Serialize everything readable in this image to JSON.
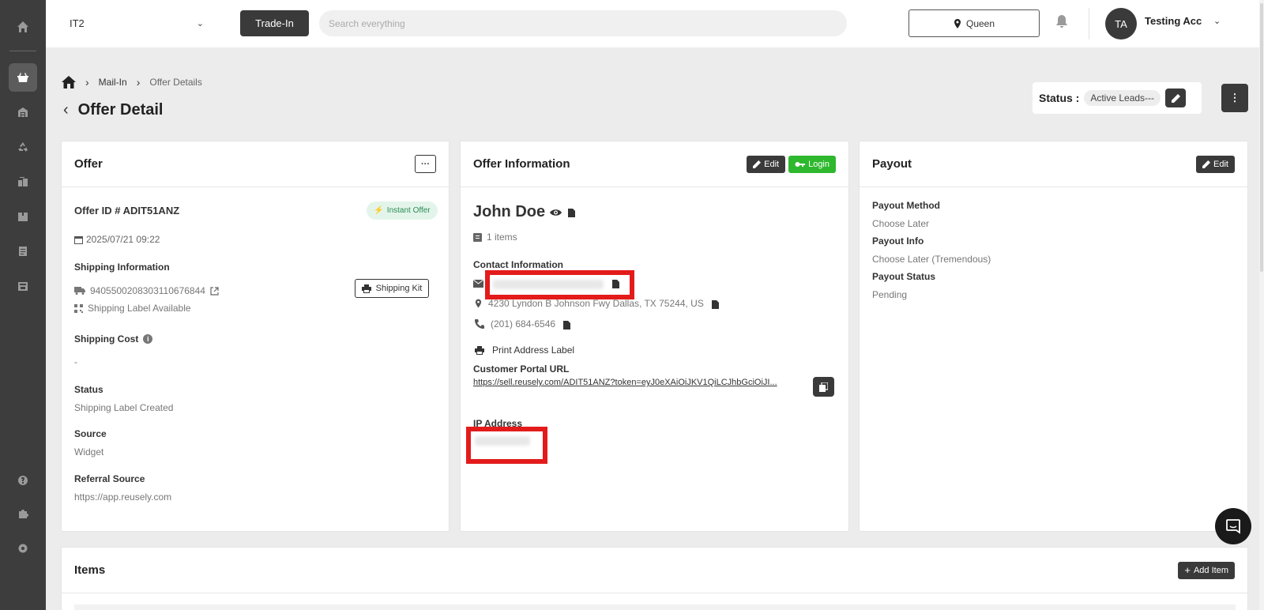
{
  "sidebar": {
    "items": [
      {
        "icon": "home-icon"
      },
      {
        "icon": "basket-icon",
        "active": true
      },
      {
        "icon": "warehouse-icon"
      },
      {
        "icon": "recycle-icon"
      },
      {
        "icon": "boxes-icon"
      },
      {
        "icon": "package-icon"
      },
      {
        "icon": "receipt-icon"
      },
      {
        "icon": "storefront-icon"
      }
    ],
    "bottom": [
      {
        "icon": "help-icon"
      },
      {
        "icon": "puzzle-icon"
      },
      {
        "icon": "settings-icon"
      }
    ]
  },
  "topbar": {
    "store": "IT2",
    "trade_in": "Trade-In",
    "search_placeholder": "Search everything",
    "location": "Queen",
    "avatar_initials": "TA",
    "user_name": "Testing Acc"
  },
  "breadcrumb": {
    "mail_in": "Mail-In",
    "current": "Offer Details"
  },
  "page": {
    "title": "Offer Detail"
  },
  "status": {
    "label": "Status :",
    "value": "Active Leads---"
  },
  "offer": {
    "title": "Offer",
    "more_label": "···",
    "offer_id": "Offer ID # ADIT51ANZ",
    "badge": "Instant Offer",
    "date": "2025/07/21 09:22",
    "shipping_info_label": "Shipping Information",
    "tracking": "9405500208303110676844",
    "shipping_kit": "Shipping Kit",
    "label_status": "Shipping Label Available",
    "shipping_cost_label": "Shipping Cost",
    "shipping_cost": "-",
    "status_label": "Status",
    "status": "Shipping Label Created",
    "source_label": "Source",
    "source": "Widget",
    "referral_label": "Referral Source",
    "referral": "https://app.reusely.com"
  },
  "info": {
    "title": "Offer Information",
    "edit": "Edit",
    "login": "Login",
    "name": "John Doe",
    "items": "1 items",
    "contact_label": "Contact Information",
    "address": "4230 Lyndon B Johnson Fwy Dallas, TX 75244, US",
    "phone": "(201) 684-6546",
    "print_label": "Print Address Label",
    "portal_label": "Customer Portal URL",
    "portal_url": "https://sell.reusely.com/ADIT51ANZ?token=eyJ0eXAiOiJKV1QiLCJhbGciOiJI...",
    "ip_label": "IP Address"
  },
  "payout": {
    "title": "Payout",
    "edit": "Edit",
    "method_label": "Payout Method",
    "method": "Choose Later",
    "info_label": "Payout Info",
    "info": "Choose Later (Tremendous)",
    "status_label": "Payout Status",
    "status": "Pending"
  },
  "items_section": {
    "title": "Items",
    "add": "Add Item"
  },
  "colors": {
    "sidebar": "#3d3d3d",
    "dark": "#3a3a3a",
    "green": "#2eb82e",
    "redact": "#e31b1b"
  }
}
